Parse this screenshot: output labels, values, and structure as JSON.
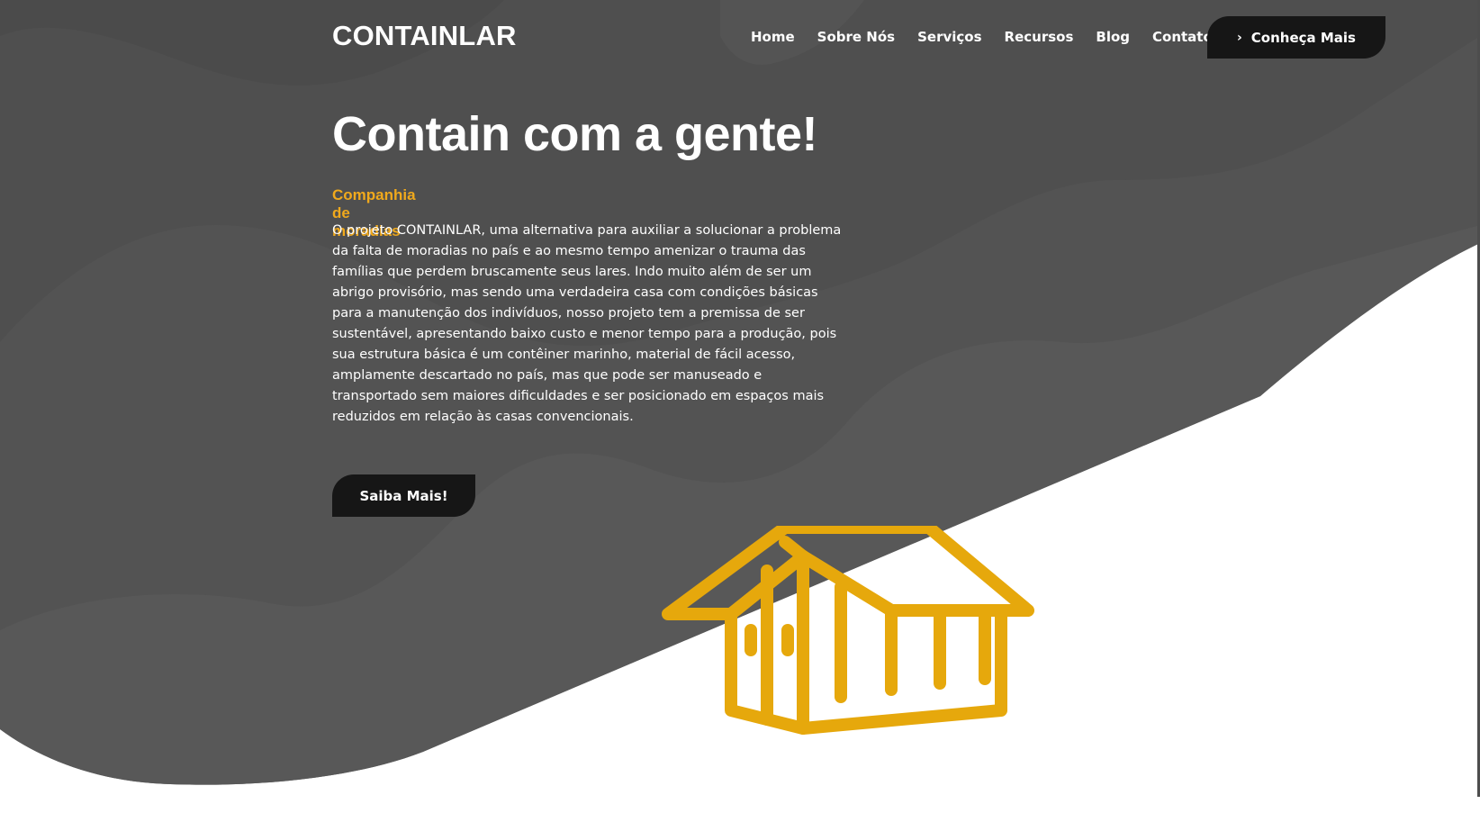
{
  "header": {
    "logo": "CONTAINLAR",
    "nav": [
      "Home",
      "Sobre Nós",
      "Serviços",
      "Recursos",
      "Blog",
      "Contato"
    ],
    "cta_label": "Conheça Mais",
    "cta_icon": "chevron-right-icon"
  },
  "hero": {
    "title": "Contain com a gente!",
    "subtitle": "Companhia de moradias",
    "description": "O projeto CONTAINLAR, uma alternativa para auxiliar a solucionar a problema da falta de moradias no país e ao mesmo tempo amenizar o trauma das famílias que perdem bruscamente seus lares. Indo muito além de ser um abrigo provisório, mas sendo uma verdadeira casa com condições básicas para a manutenção dos indivíduos, nosso projeto tem a premissa de ser sustentável, apresentando baixo custo e menor tempo para a produção, pois sua estrutura básica é um contêiner marinho, material de fácil acesso, amplamente descartado no país, mas que pode ser manuseado e transportado sem maiores dificuldades e ser posicionado em espaços mais reduzidos em relação às casas convencionais.",
    "button_label": "Saiba Mais!",
    "illustration_icon": "container-house-icon"
  },
  "colors": {
    "background_dark": "#4f4f4f",
    "wave_light": "#5a5a5a",
    "accent": "#f0a91c",
    "illustration": "#e6a80c",
    "button": "#161616",
    "text": "#ffffff"
  }
}
